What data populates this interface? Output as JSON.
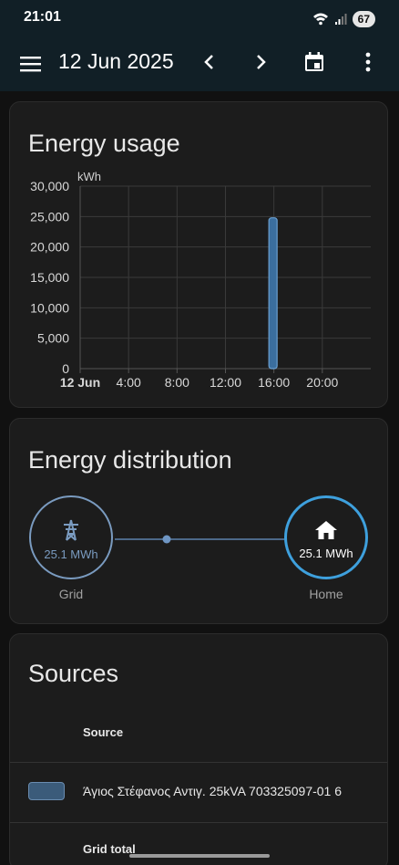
{
  "status": {
    "time": "21:01",
    "battery": "67"
  },
  "appbar": {
    "date": "12 Jun 2025"
  },
  "usage_card": {
    "title": "Energy usage"
  },
  "chart_data": {
    "type": "bar",
    "ylabel": "kWh",
    "yticks": [
      "30,000",
      "25,000",
      "20,000",
      "15,000",
      "10,000",
      "5,000",
      "0"
    ],
    "ylim": [
      0,
      30000
    ],
    "xticks": [
      "12 Jun",
      "4:00",
      "8:00",
      "12:00",
      "16:00",
      "20:00"
    ],
    "xlim_hours": [
      0,
      24
    ],
    "grid": true,
    "series": [
      {
        "hours": [
          16
        ],
        "values": [
          24800
        ],
        "color": "#3b6e9e"
      }
    ]
  },
  "distribution_card": {
    "title": "Energy distribution",
    "grid": {
      "value": "25.1 MWh",
      "label": "Grid"
    },
    "home": {
      "value": "25.1 MWh",
      "label": "Home"
    }
  },
  "sources_card": {
    "title": "Sources",
    "header": "Source",
    "rows": [
      {
        "name": "Άγιος Στέφανος Αντιγ. 25kVA 703325097-01 6"
      }
    ],
    "total_label": "Grid total"
  },
  "colors": {
    "appbar": "#111f26",
    "accent": "#3ea0dd",
    "bar": "#3b6e9e"
  }
}
